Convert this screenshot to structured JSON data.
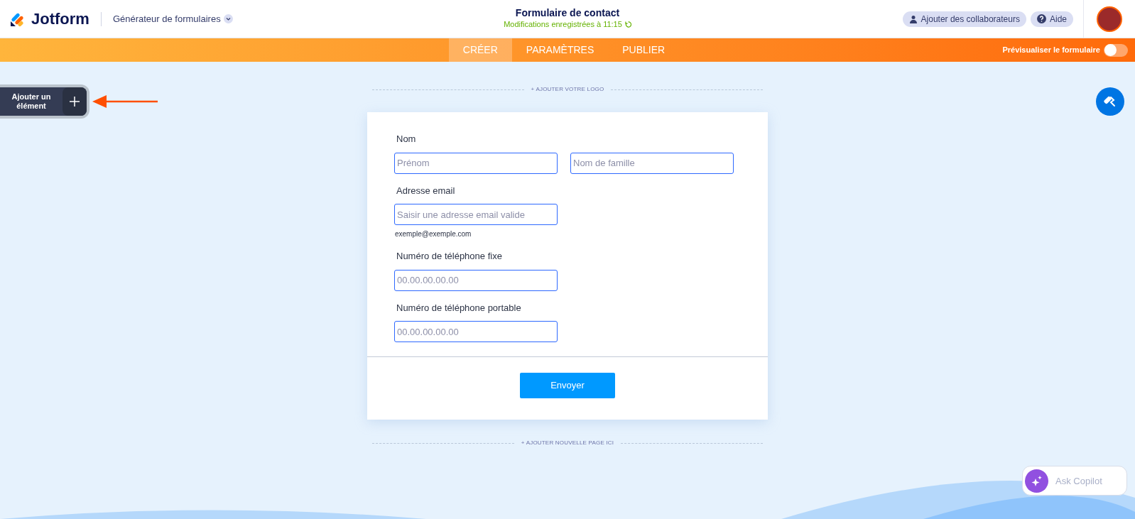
{
  "header": {
    "logo_text": "Jotform",
    "product_menu": "Générateur de formulaires",
    "title": "Formulaire de contact",
    "save_status": "Modifications enregistrées à 11:15",
    "buttons": [
      {
        "kind": "collaborators",
        "label": "Ajouter des collaborateurs"
      },
      {
        "kind": "help",
        "label": "Aide"
      }
    ]
  },
  "tabs": [
    {
      "label": "CRÉER",
      "selected": true
    },
    {
      "label": "PARAMÈTRES",
      "selected": false
    },
    {
      "label": "PUBLIER",
      "selected": false
    }
  ],
  "preview_toggle": {
    "label": "Prévisualiser le formulaire",
    "on": false
  },
  "add_element": {
    "label": "Ajouter un élément"
  },
  "add_logo": "+ AJOUTER VOTRE LOGO",
  "form": {
    "fields": [
      {
        "label": "Nom",
        "inputs": [
          {
            "placeholder": "Prénom"
          },
          {
            "placeholder": "Nom de famille"
          }
        ]
      },
      {
        "label": "Adresse email",
        "inputs": [
          {
            "placeholder": "Saisir une adresse email valide"
          }
        ],
        "sublabel": "exemple@exemple.com"
      },
      {
        "label": "Numéro de téléphone fixe",
        "inputs": [
          {
            "placeholder": "00.00.00.00.00"
          }
        ]
      },
      {
        "label": "Numéro de téléphone portable",
        "inputs": [
          {
            "placeholder": "00.00.00.00.00"
          }
        ]
      }
    ],
    "submit": "Envoyer"
  },
  "add_page": "+ AJOUTER NOUVELLE PAGE ICI",
  "copilot": {
    "placeholder": "Ask Copilot"
  }
}
